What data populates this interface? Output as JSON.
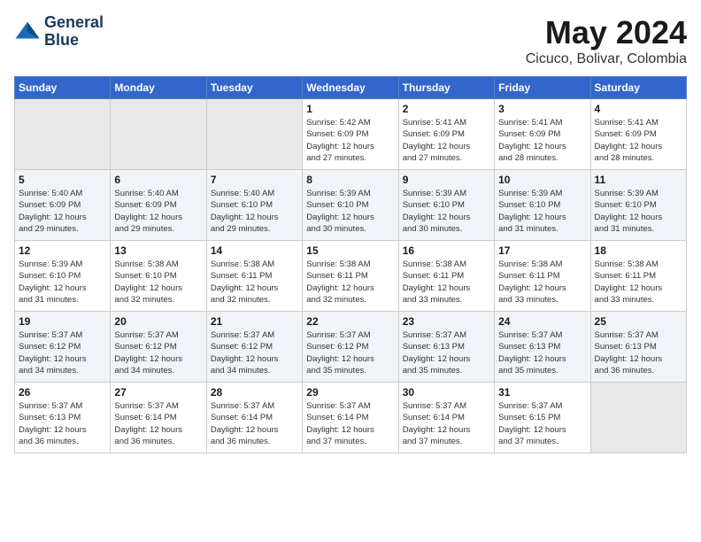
{
  "header": {
    "logo_line1": "General",
    "logo_line2": "Blue",
    "month_year": "May 2024",
    "location": "Cicuco, Bolivar, Colombia"
  },
  "weekdays": [
    "Sunday",
    "Monday",
    "Tuesday",
    "Wednesday",
    "Thursday",
    "Friday",
    "Saturday"
  ],
  "weeks": [
    [
      {
        "day": "",
        "info": ""
      },
      {
        "day": "",
        "info": ""
      },
      {
        "day": "",
        "info": ""
      },
      {
        "day": "1",
        "info": "Sunrise: 5:42 AM\nSunset: 6:09 PM\nDaylight: 12 hours\nand 27 minutes."
      },
      {
        "day": "2",
        "info": "Sunrise: 5:41 AM\nSunset: 6:09 PM\nDaylight: 12 hours\nand 27 minutes."
      },
      {
        "day": "3",
        "info": "Sunrise: 5:41 AM\nSunset: 6:09 PM\nDaylight: 12 hours\nand 28 minutes."
      },
      {
        "day": "4",
        "info": "Sunrise: 5:41 AM\nSunset: 6:09 PM\nDaylight: 12 hours\nand 28 minutes."
      }
    ],
    [
      {
        "day": "5",
        "info": "Sunrise: 5:40 AM\nSunset: 6:09 PM\nDaylight: 12 hours\nand 29 minutes."
      },
      {
        "day": "6",
        "info": "Sunrise: 5:40 AM\nSunset: 6:09 PM\nDaylight: 12 hours\nand 29 minutes."
      },
      {
        "day": "7",
        "info": "Sunrise: 5:40 AM\nSunset: 6:10 PM\nDaylight: 12 hours\nand 29 minutes."
      },
      {
        "day": "8",
        "info": "Sunrise: 5:39 AM\nSunset: 6:10 PM\nDaylight: 12 hours\nand 30 minutes."
      },
      {
        "day": "9",
        "info": "Sunrise: 5:39 AM\nSunset: 6:10 PM\nDaylight: 12 hours\nand 30 minutes."
      },
      {
        "day": "10",
        "info": "Sunrise: 5:39 AM\nSunset: 6:10 PM\nDaylight: 12 hours\nand 31 minutes."
      },
      {
        "day": "11",
        "info": "Sunrise: 5:39 AM\nSunset: 6:10 PM\nDaylight: 12 hours\nand 31 minutes."
      }
    ],
    [
      {
        "day": "12",
        "info": "Sunrise: 5:39 AM\nSunset: 6:10 PM\nDaylight: 12 hours\nand 31 minutes."
      },
      {
        "day": "13",
        "info": "Sunrise: 5:38 AM\nSunset: 6:10 PM\nDaylight: 12 hours\nand 32 minutes."
      },
      {
        "day": "14",
        "info": "Sunrise: 5:38 AM\nSunset: 6:11 PM\nDaylight: 12 hours\nand 32 minutes."
      },
      {
        "day": "15",
        "info": "Sunrise: 5:38 AM\nSunset: 6:11 PM\nDaylight: 12 hours\nand 32 minutes."
      },
      {
        "day": "16",
        "info": "Sunrise: 5:38 AM\nSunset: 6:11 PM\nDaylight: 12 hours\nand 33 minutes."
      },
      {
        "day": "17",
        "info": "Sunrise: 5:38 AM\nSunset: 6:11 PM\nDaylight: 12 hours\nand 33 minutes."
      },
      {
        "day": "18",
        "info": "Sunrise: 5:38 AM\nSunset: 6:11 PM\nDaylight: 12 hours\nand 33 minutes."
      }
    ],
    [
      {
        "day": "19",
        "info": "Sunrise: 5:37 AM\nSunset: 6:12 PM\nDaylight: 12 hours\nand 34 minutes."
      },
      {
        "day": "20",
        "info": "Sunrise: 5:37 AM\nSunset: 6:12 PM\nDaylight: 12 hours\nand 34 minutes."
      },
      {
        "day": "21",
        "info": "Sunrise: 5:37 AM\nSunset: 6:12 PM\nDaylight: 12 hours\nand 34 minutes."
      },
      {
        "day": "22",
        "info": "Sunrise: 5:37 AM\nSunset: 6:12 PM\nDaylight: 12 hours\nand 35 minutes."
      },
      {
        "day": "23",
        "info": "Sunrise: 5:37 AM\nSunset: 6:13 PM\nDaylight: 12 hours\nand 35 minutes."
      },
      {
        "day": "24",
        "info": "Sunrise: 5:37 AM\nSunset: 6:13 PM\nDaylight: 12 hours\nand 35 minutes."
      },
      {
        "day": "25",
        "info": "Sunrise: 5:37 AM\nSunset: 6:13 PM\nDaylight: 12 hours\nand 36 minutes."
      }
    ],
    [
      {
        "day": "26",
        "info": "Sunrise: 5:37 AM\nSunset: 6:13 PM\nDaylight: 12 hours\nand 36 minutes."
      },
      {
        "day": "27",
        "info": "Sunrise: 5:37 AM\nSunset: 6:14 PM\nDaylight: 12 hours\nand 36 minutes."
      },
      {
        "day": "28",
        "info": "Sunrise: 5:37 AM\nSunset: 6:14 PM\nDaylight: 12 hours\nand 36 minutes."
      },
      {
        "day": "29",
        "info": "Sunrise: 5:37 AM\nSunset: 6:14 PM\nDaylight: 12 hours\nand 37 minutes."
      },
      {
        "day": "30",
        "info": "Sunrise: 5:37 AM\nSunset: 6:14 PM\nDaylight: 12 hours\nand 37 minutes."
      },
      {
        "day": "31",
        "info": "Sunrise: 5:37 AM\nSunset: 6:15 PM\nDaylight: 12 hours\nand 37 minutes."
      },
      {
        "day": "",
        "info": ""
      }
    ]
  ]
}
